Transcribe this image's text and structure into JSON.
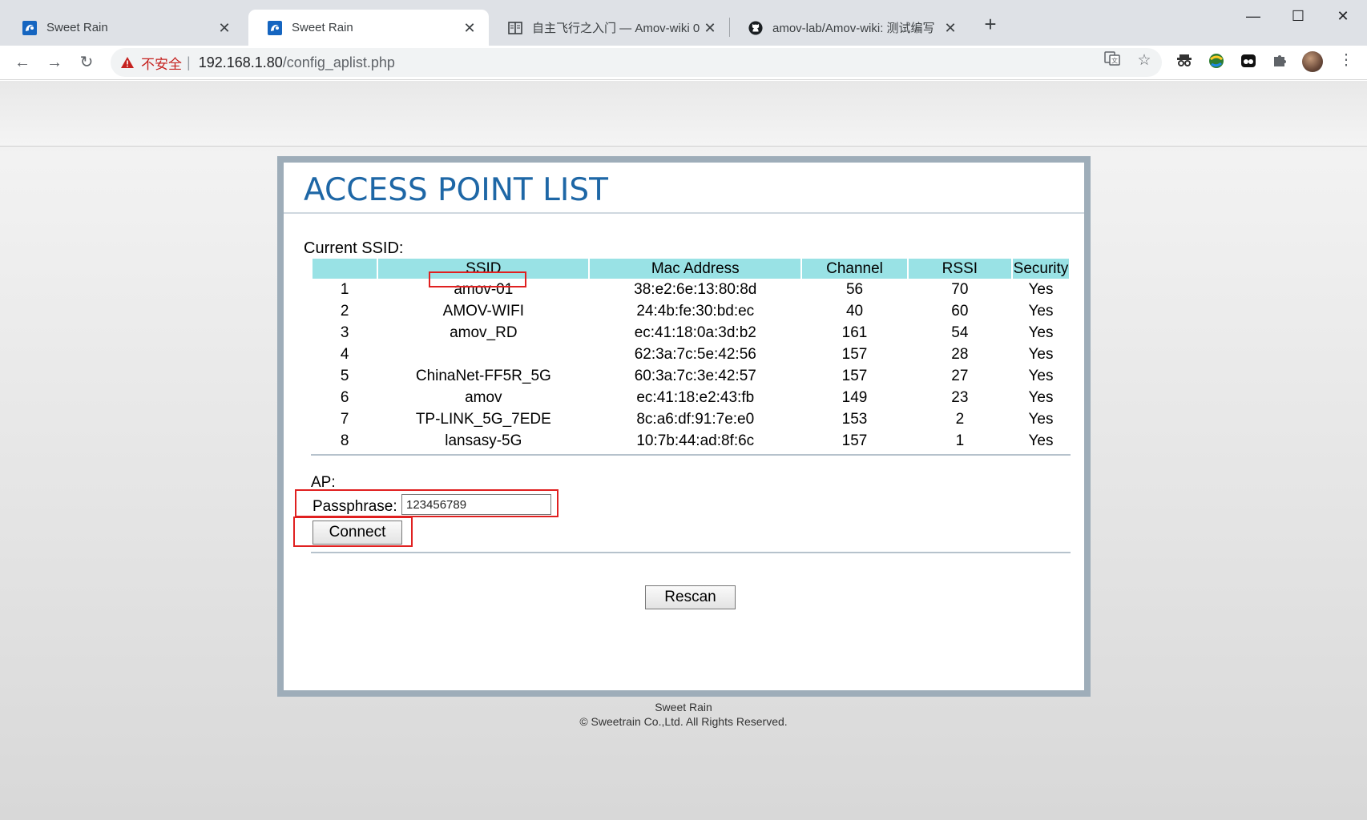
{
  "browser": {
    "tabs": [
      {
        "title": "Sweet Rain",
        "icon": "sweetrain-logo-icon",
        "active": false
      },
      {
        "title": "Sweet Rain",
        "icon": "sweetrain-logo-icon",
        "active": true
      },
      {
        "title": "自主飞行之入门 — Amov-wiki 0",
        "icon": "book-icon",
        "active": false
      },
      {
        "title": "amov-lab/Amov-wiki: 测试编写",
        "icon": "github-icon",
        "active": false
      }
    ],
    "new_tab": "+",
    "window_controls": {
      "minimize": "—",
      "maximize": "☐",
      "close": "✕"
    },
    "address": {
      "security_label": "不安全",
      "separator": "|",
      "host": "192.168.1.80",
      "path": "/config_aplist.php"
    }
  },
  "page": {
    "title": "ACCESS POINT LIST",
    "current_ssid_label": "Current SSID:",
    "table": {
      "headers": [
        "",
        "SSID",
        "Mac Address",
        "Channel",
        "RSSI",
        "Security"
      ],
      "rows": [
        [
          "1",
          "amov-01",
          "38:e2:6e:13:80:8d",
          "56",
          "70",
          "Yes"
        ],
        [
          "2",
          "AMOV-WIFI",
          "24:4b:fe:30:bd:ec",
          "40",
          "60",
          "Yes"
        ],
        [
          "3",
          "amov_RD",
          "ec:41:18:0a:3d:b2",
          "161",
          "54",
          "Yes"
        ],
        [
          "4",
          "",
          "62:3a:7c:5e:42:56",
          "157",
          "28",
          "Yes"
        ],
        [
          "5",
          "ChinaNet-FF5R_5G",
          "60:3a:7c:3e:42:57",
          "157",
          "27",
          "Yes"
        ],
        [
          "6",
          "amov",
          "ec:41:18:e2:43:fb",
          "149",
          "23",
          "Yes"
        ],
        [
          "7",
          "TP-LINK_5G_7EDE",
          "8c:a6:df:91:7e:e0",
          "153",
          "2",
          "Yes"
        ],
        [
          "8",
          "lansasy-5G",
          "10:7b:44:ad:8f:6c",
          "157",
          "1",
          "Yes"
        ]
      ]
    },
    "ap_label": "AP:",
    "passphrase_label": "Passphrase:",
    "passphrase_value": "123456789",
    "connect_label": "Connect",
    "rescan_label": "Rescan"
  },
  "footer": {
    "line1": "Sweet Rain",
    "line2": "© Sweetrain Co.,Ltd. All Rights Reserved."
  },
  "colors": {
    "title": "#1e67a6",
    "header_bg": "#99e2e5",
    "highlight": "#e02020",
    "not_secure": "#c5221f"
  }
}
